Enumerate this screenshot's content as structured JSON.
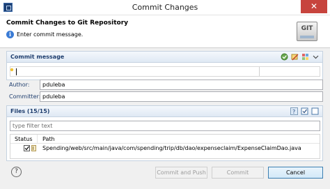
{
  "window": {
    "title": "Commit Changes",
    "close_glyph": "✕"
  },
  "header": {
    "title": "Commit Changes to Git Repository",
    "message": "Enter commit message.",
    "info_glyph": "i",
    "logo_text": "GIT"
  },
  "commit_message": {
    "section_title": "Commit message",
    "toolbar_icons": [
      "add-signed-off-by-icon",
      "amend-previous-commit-icon",
      "compute-change-id-icon",
      "menu-chevron-icon"
    ],
    "value": ""
  },
  "author": {
    "label": "Author:",
    "value": "pduleba"
  },
  "committer": {
    "label": "Committer:",
    "value": "pduleba"
  },
  "files": {
    "section_title": "Files (15/15)",
    "filter_placeholder": "type filter text",
    "columns": {
      "status": "Status",
      "path": "Path"
    },
    "rows": [
      {
        "path": "Spending/web/src/main/java/com/spending/trip/db/dao/expenseclaim/ExpenseClaimDao.java",
        "checked": true
      }
    ]
  },
  "buttons": {
    "help_glyph": "?",
    "commit_and_push": "Commit and Push",
    "commit": "Commit",
    "cancel": "Cancel"
  },
  "colors": {
    "section_title": "#1f3e6e",
    "close_button": "#c7443d",
    "accent": "#3c7fb1"
  }
}
